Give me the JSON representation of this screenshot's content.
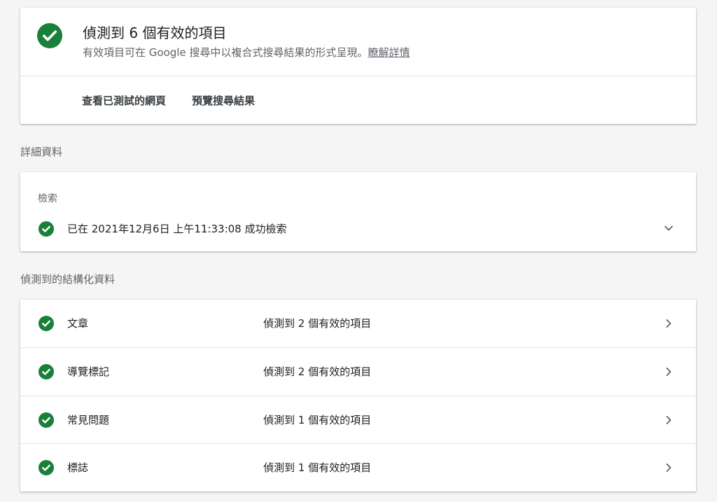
{
  "summary": {
    "title": "偵測到 6 個有效的項目",
    "description": "有效項目可在 Google 搜尋中以複合式搜尋結果的形式呈現。",
    "learn_more": "瞭解詳情",
    "actions": [
      "查看已測試的網頁",
      "預覽搜尋結果"
    ],
    "status_color": "#188038"
  },
  "details": {
    "heading": "詳細資料",
    "crawl": {
      "label": "檢索",
      "status": "已在 2021年12月6日 上午11:33:08 成功檢索",
      "expand_icon": "chevron-down-icon"
    }
  },
  "structured": {
    "heading": "偵測到的結構化資料",
    "items": [
      {
        "name": "文章",
        "count": "偵測到 2 個有效的項目"
      },
      {
        "name": "導覽標記",
        "count": "偵測到 2 個有效的項目"
      },
      {
        "name": "常見問題",
        "count": "偵測到 1 個有效的項目"
      },
      {
        "name": "標誌",
        "count": "偵測到 1 個有效的項目"
      }
    ],
    "row_icon": "chevron-right-icon"
  }
}
